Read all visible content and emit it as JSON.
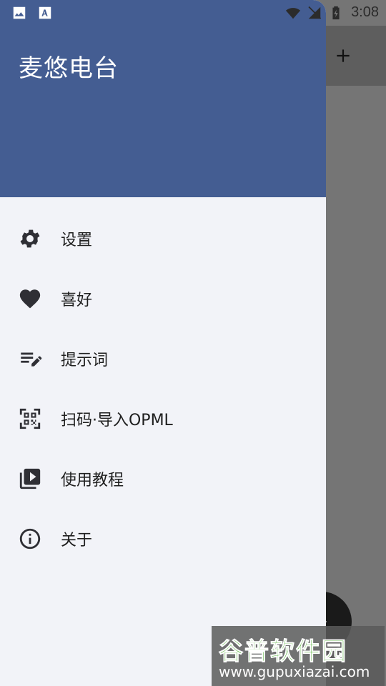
{
  "app": {
    "title": "麦悠电台"
  },
  "status_bar": {
    "time": "3:08"
  },
  "menu": [
    {
      "label": "设置",
      "icon": "gear-icon"
    },
    {
      "label": "喜好",
      "icon": "heart-icon"
    },
    {
      "label": "提示词",
      "icon": "edit-list-icon"
    },
    {
      "label": "扫码·导入OPML",
      "icon": "qr-code-icon"
    },
    {
      "label": "使用教程",
      "icon": "video-library-icon"
    },
    {
      "label": "关于",
      "icon": "info-icon"
    }
  ],
  "watermark": {
    "title": "谷普软件园",
    "url": "www.gupuxiazai.com"
  },
  "colors": {
    "header": "#445d92",
    "drawer_bg": "#f2f3f8",
    "dim": "#757575"
  }
}
